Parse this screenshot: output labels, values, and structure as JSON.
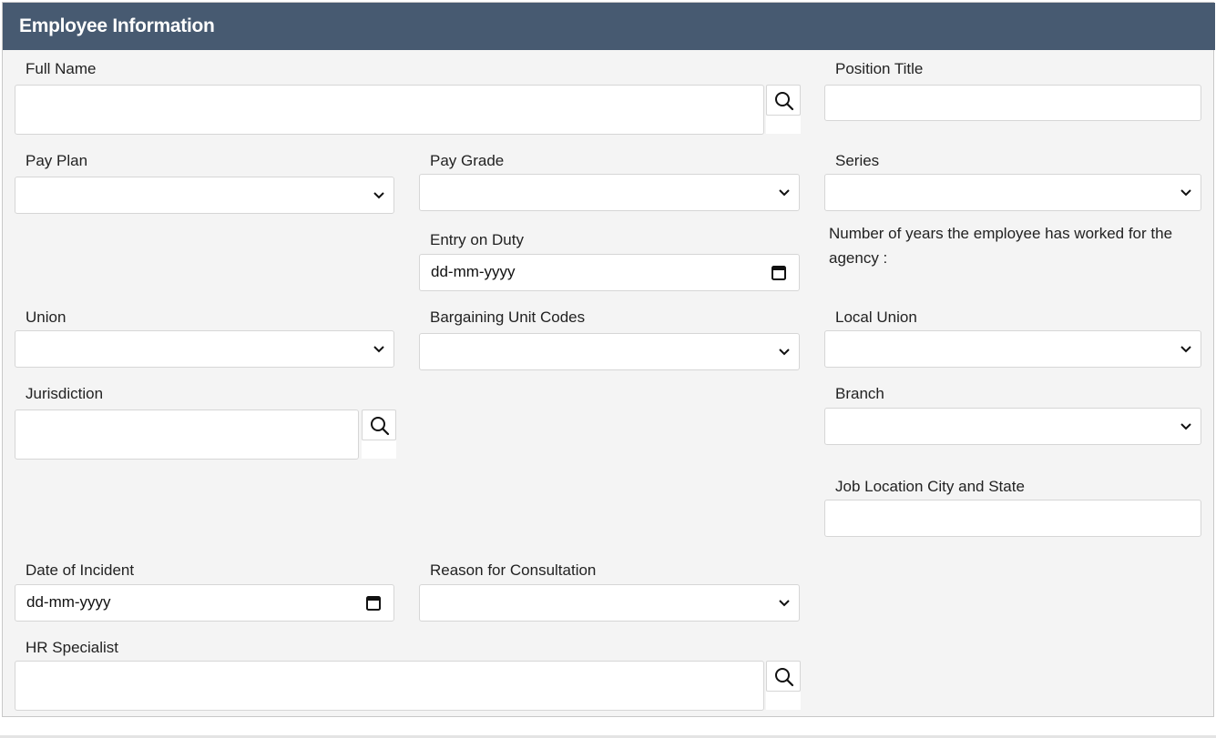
{
  "header": {
    "title": "Employee Information"
  },
  "fields": {
    "full_name": {
      "label": "Full Name",
      "value": ""
    },
    "position_title": {
      "label": "Position Title",
      "value": ""
    },
    "pay_plan": {
      "label": "Pay Plan",
      "value": ""
    },
    "pay_grade": {
      "label": "Pay Grade",
      "value": ""
    },
    "series": {
      "label": "Series",
      "value": ""
    },
    "entry_on_duty": {
      "label": "Entry on Duty",
      "placeholder": "dd-mm-yyyy"
    },
    "years_note": "Number of years the employee has worked for the agency :",
    "union": {
      "label": "Union",
      "value": ""
    },
    "bargaining_unit_codes": {
      "label": "Bargaining Unit Codes",
      "value": ""
    },
    "local_union": {
      "label": "Local Union",
      "value": ""
    },
    "jurisdiction": {
      "label": "Jurisdiction",
      "value": ""
    },
    "branch": {
      "label": "Branch",
      "value": ""
    },
    "job_location": {
      "label": "Job Location City and State",
      "value": ""
    },
    "date_of_incident": {
      "label": "Date of Incident",
      "placeholder": "dd-mm-yyyy"
    },
    "reason_for_consultation": {
      "label": "Reason for Consultation",
      "value": ""
    },
    "hr_specialist": {
      "label": "HR Specialist",
      "value": ""
    }
  },
  "icons": {
    "search": "search-icon",
    "chevron": "chevron-down-icon",
    "calendar": "calendar-icon"
  },
  "colors": {
    "header_bg": "#475a71",
    "panel_bg": "#f4f4f4",
    "field_border": "#d6d6d6"
  }
}
